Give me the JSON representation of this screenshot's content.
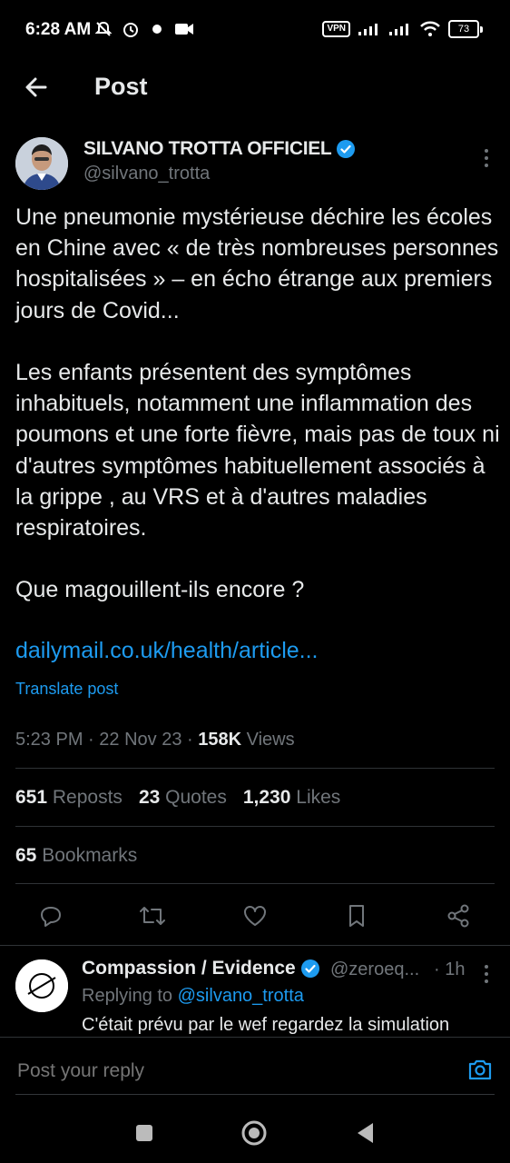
{
  "status_bar": {
    "time": "6:28 AM",
    "vpn": "VPN",
    "battery": "73"
  },
  "header": {
    "title": "Post"
  },
  "post": {
    "author_name": "SILVANO TROTTA OFFICIEL",
    "author_handle": "@silvano_trotta",
    "text": "Une pneumonie mystérieuse déchire les écoles en Chine avec « de très nombreuses personnes hospitalisées » – en écho étrange aux premiers jours de Covid...\n\nLes enfants présentent des symptômes inhabituels, notamment une inflammation des poumons et une forte fièvre, mais pas de toux ni d'autres symptômes habituellement associés à la grippe , au VRS et à d'autres maladies respiratoires.\n\nQue magouillent-ils encore ?",
    "link": "dailymail.co.uk/health/article...",
    "translate": "Translate post",
    "time": "5:23 PM",
    "date": "22 Nov 23",
    "views_count": "158K",
    "views_label": "Views"
  },
  "stats": {
    "reposts_count": "651",
    "reposts_label": "Reposts",
    "quotes_count": "23",
    "quotes_label": "Quotes",
    "likes_count": "1,230",
    "likes_label": "Likes",
    "bookmarks_count": "65",
    "bookmarks_label": "Bookmarks"
  },
  "reply": {
    "name": "Compassion / Evidence",
    "handle": "@zeroeq...",
    "time": "· 1h",
    "replying_prefix": "Replying to ",
    "replying_handle": "@silvano_trotta",
    "text": "C'était prévu par le wef regardez la simulation"
  },
  "reply_bar": {
    "placeholder": "Post your reply"
  },
  "colors": {
    "accent": "#1d9bf0",
    "background": "#000000",
    "secondary_text": "#71767b"
  },
  "icons": [
    "back-arrow-icon",
    "verified-icon",
    "more-icon",
    "reply-icon",
    "repost-icon",
    "like-icon",
    "bookmark-icon",
    "share-icon",
    "camera-icon"
  ]
}
